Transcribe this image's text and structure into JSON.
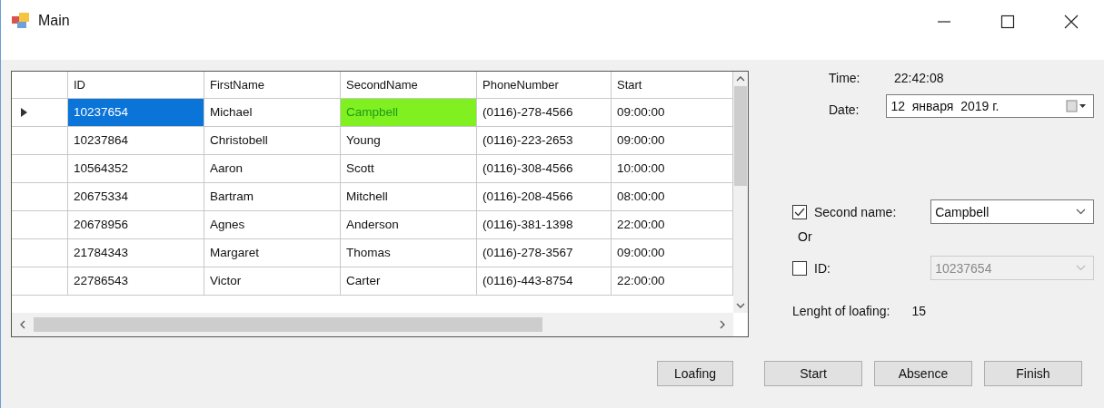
{
  "window": {
    "title": "Main"
  },
  "table": {
    "columns": [
      "ID",
      "FirstName",
      "SecondName",
      "PhoneNumber",
      "Start"
    ],
    "rows": [
      {
        "current": true,
        "cells": [
          {
            "text": "10237654",
            "selected": true,
            "highlighted": false
          },
          {
            "text": "Michael",
            "selected": false,
            "highlighted": false
          },
          {
            "text": "Campbell",
            "selected": false,
            "highlighted": true
          },
          {
            "text": "(0116)-278-4566",
            "selected": false,
            "highlighted": false
          },
          {
            "text": "09:00:00",
            "selected": false,
            "highlighted": false
          }
        ]
      },
      {
        "current": false,
        "cells": [
          {
            "text": "10237864",
            "selected": false,
            "highlighted": false
          },
          {
            "text": "Christobell",
            "selected": false,
            "highlighted": false
          },
          {
            "text": "Young",
            "selected": false,
            "highlighted": false
          },
          {
            "text": "(0116)-223-2653",
            "selected": false,
            "highlighted": false
          },
          {
            "text": "09:00:00",
            "selected": false,
            "highlighted": false
          }
        ]
      },
      {
        "current": false,
        "cells": [
          {
            "text": "10564352",
            "selected": false,
            "highlighted": false
          },
          {
            "text": "Aaron",
            "selected": false,
            "highlighted": false
          },
          {
            "text": "Scott",
            "selected": false,
            "highlighted": false
          },
          {
            "text": "(0116)-308-4566",
            "selected": false,
            "highlighted": false
          },
          {
            "text": "10:00:00",
            "selected": false,
            "highlighted": false
          }
        ]
      },
      {
        "current": false,
        "cells": [
          {
            "text": "20675334",
            "selected": false,
            "highlighted": false
          },
          {
            "text": "Bartram",
            "selected": false,
            "highlighted": false
          },
          {
            "text": "Mitchell",
            "selected": false,
            "highlighted": false
          },
          {
            "text": "(0116)-208-4566",
            "selected": false,
            "highlighted": false
          },
          {
            "text": "08:00:00",
            "selected": false,
            "highlighted": false
          }
        ]
      },
      {
        "current": false,
        "cells": [
          {
            "text": "20678956",
            "selected": false,
            "highlighted": false
          },
          {
            "text": "Agnes",
            "selected": false,
            "highlighted": false
          },
          {
            "text": "Anderson",
            "selected": false,
            "highlighted": false
          },
          {
            "text": "(0116)-381-1398",
            "selected": false,
            "highlighted": false
          },
          {
            "text": "22:00:00",
            "selected": false,
            "highlighted": false
          }
        ]
      },
      {
        "current": false,
        "cells": [
          {
            "text": "21784343",
            "selected": false,
            "highlighted": false
          },
          {
            "text": "Margaret",
            "selected": false,
            "highlighted": false
          },
          {
            "text": "Thomas",
            "selected": false,
            "highlighted": false
          },
          {
            "text": "(0116)-278-3567",
            "selected": false,
            "highlighted": false
          },
          {
            "text": "09:00:00",
            "selected": false,
            "highlighted": false
          }
        ]
      },
      {
        "current": false,
        "cells": [
          {
            "text": "22786543",
            "selected": false,
            "highlighted": false
          },
          {
            "text": "Victor",
            "selected": false,
            "highlighted": false
          },
          {
            "text": "Carter",
            "selected": false,
            "highlighted": false
          },
          {
            "text": "(0116)-443-8754",
            "selected": false,
            "highlighted": false
          },
          {
            "text": "22:00:00",
            "selected": false,
            "highlighted": false
          }
        ]
      }
    ]
  },
  "panel": {
    "time_label": "Time:",
    "time": "22:42:08",
    "date_label": "Date:",
    "date": "12  января  2019 г.",
    "second_name": {
      "label": "Second name:",
      "checked": true,
      "value": "Campbell",
      "disabled": false
    },
    "or_label": "Or",
    "id": {
      "label": "ID:",
      "checked": false,
      "value": "10237654",
      "disabled": true
    },
    "loafing_label": "Lenght of loafing:",
    "loafing": "15"
  },
  "buttons": [
    "Loafing",
    "Start",
    "Absence",
    "Finish"
  ]
}
